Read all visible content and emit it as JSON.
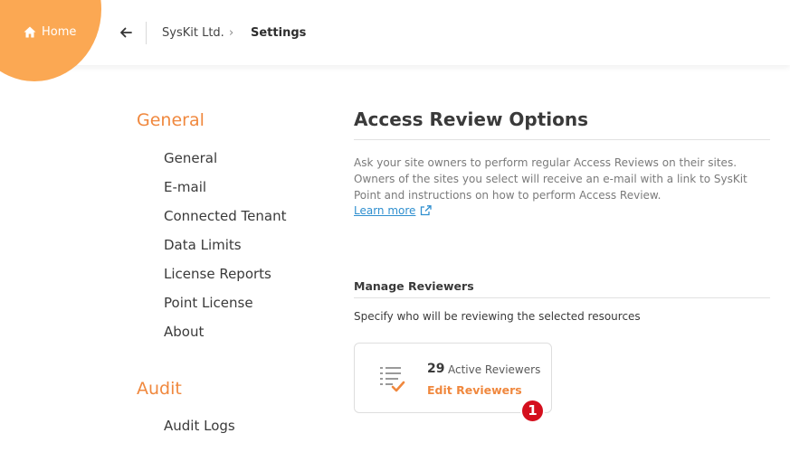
{
  "header": {
    "home_label": "Home",
    "breadcrumb": {
      "org": "SysKit Ltd.",
      "separator": "›",
      "current": "Settings"
    }
  },
  "sidebar": {
    "sections": [
      {
        "title": "General",
        "items": [
          "General",
          "E-mail",
          "Connected Tenant",
          "Data Limits",
          "License Reports",
          "Point License",
          "About"
        ]
      },
      {
        "title": "Audit",
        "items": [
          "Audit Logs"
        ]
      }
    ]
  },
  "main": {
    "title": "Access Review Options",
    "description": "Ask your site owners to perform regular Access Reviews on their sites. Owners of the sites you select will receive an e-mail with a link to SysKit Point and instructions on how to perform Access Review.",
    "learn_more": "Learn more",
    "manage": {
      "title": "Manage Reviewers",
      "description": "Specify who will be reviewing the selected resources",
      "card": {
        "count": "29",
        "count_label": "Active Reviewers",
        "action": "Edit Reviewers"
      }
    },
    "step_badge": "1"
  },
  "icons": {
    "home": "home-icon",
    "back": "arrow-left-icon",
    "external": "external-link-icon",
    "reviewers": "checklist-icon"
  },
  "colors": {
    "accent_orange": "#f0883e",
    "home_blob": "#fba853",
    "link_blue": "#2f8fcf",
    "badge_red": "#d40f1d"
  }
}
